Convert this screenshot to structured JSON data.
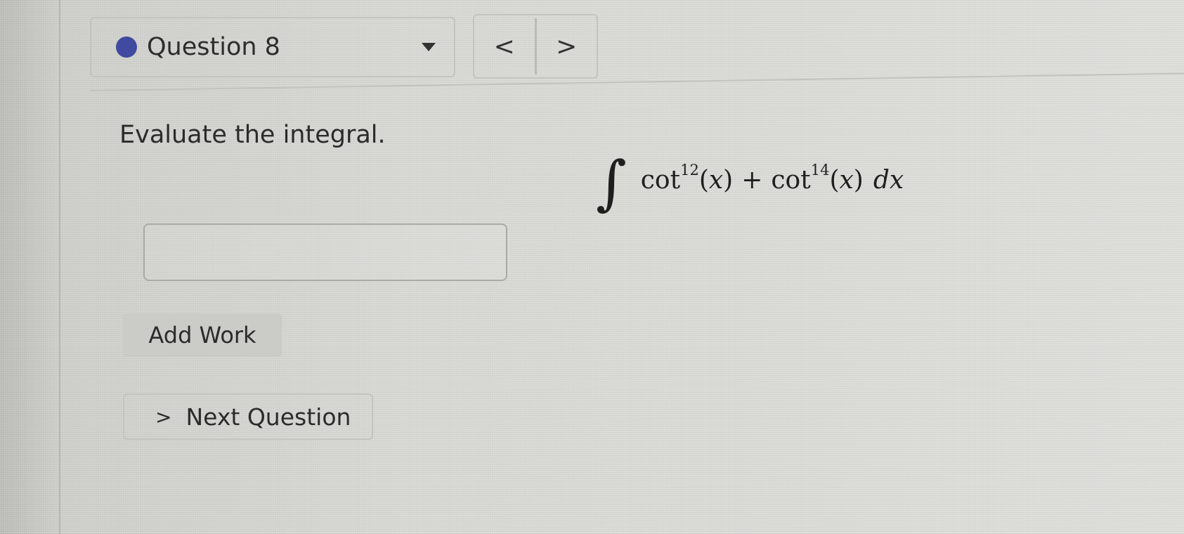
{
  "header": {
    "question_label": "Question 8",
    "status_color": "#3f4aa0",
    "dropdown_icon": "caret-down-icon",
    "prev_label": "<",
    "next_label": ">"
  },
  "question": {
    "prompt": "Evaluate the integral.",
    "integral": {
      "integral_sign": "∫",
      "term1_func": "cot",
      "term1_power": "12",
      "term1_arg_open": "(",
      "term1_var": "x",
      "term1_arg_close": ")",
      "operator": "+",
      "term2_func": "cot",
      "term2_power": "14",
      "term2_arg_open": "(",
      "term2_var": "x",
      "term2_arg_close": ")",
      "differential_d": "d",
      "differential_var": "x"
    }
  },
  "answer": {
    "value": "",
    "placeholder": ""
  },
  "actions": {
    "add_work_label": "Add Work",
    "next_question_label": "Next Question",
    "next_question_icon": ">"
  }
}
